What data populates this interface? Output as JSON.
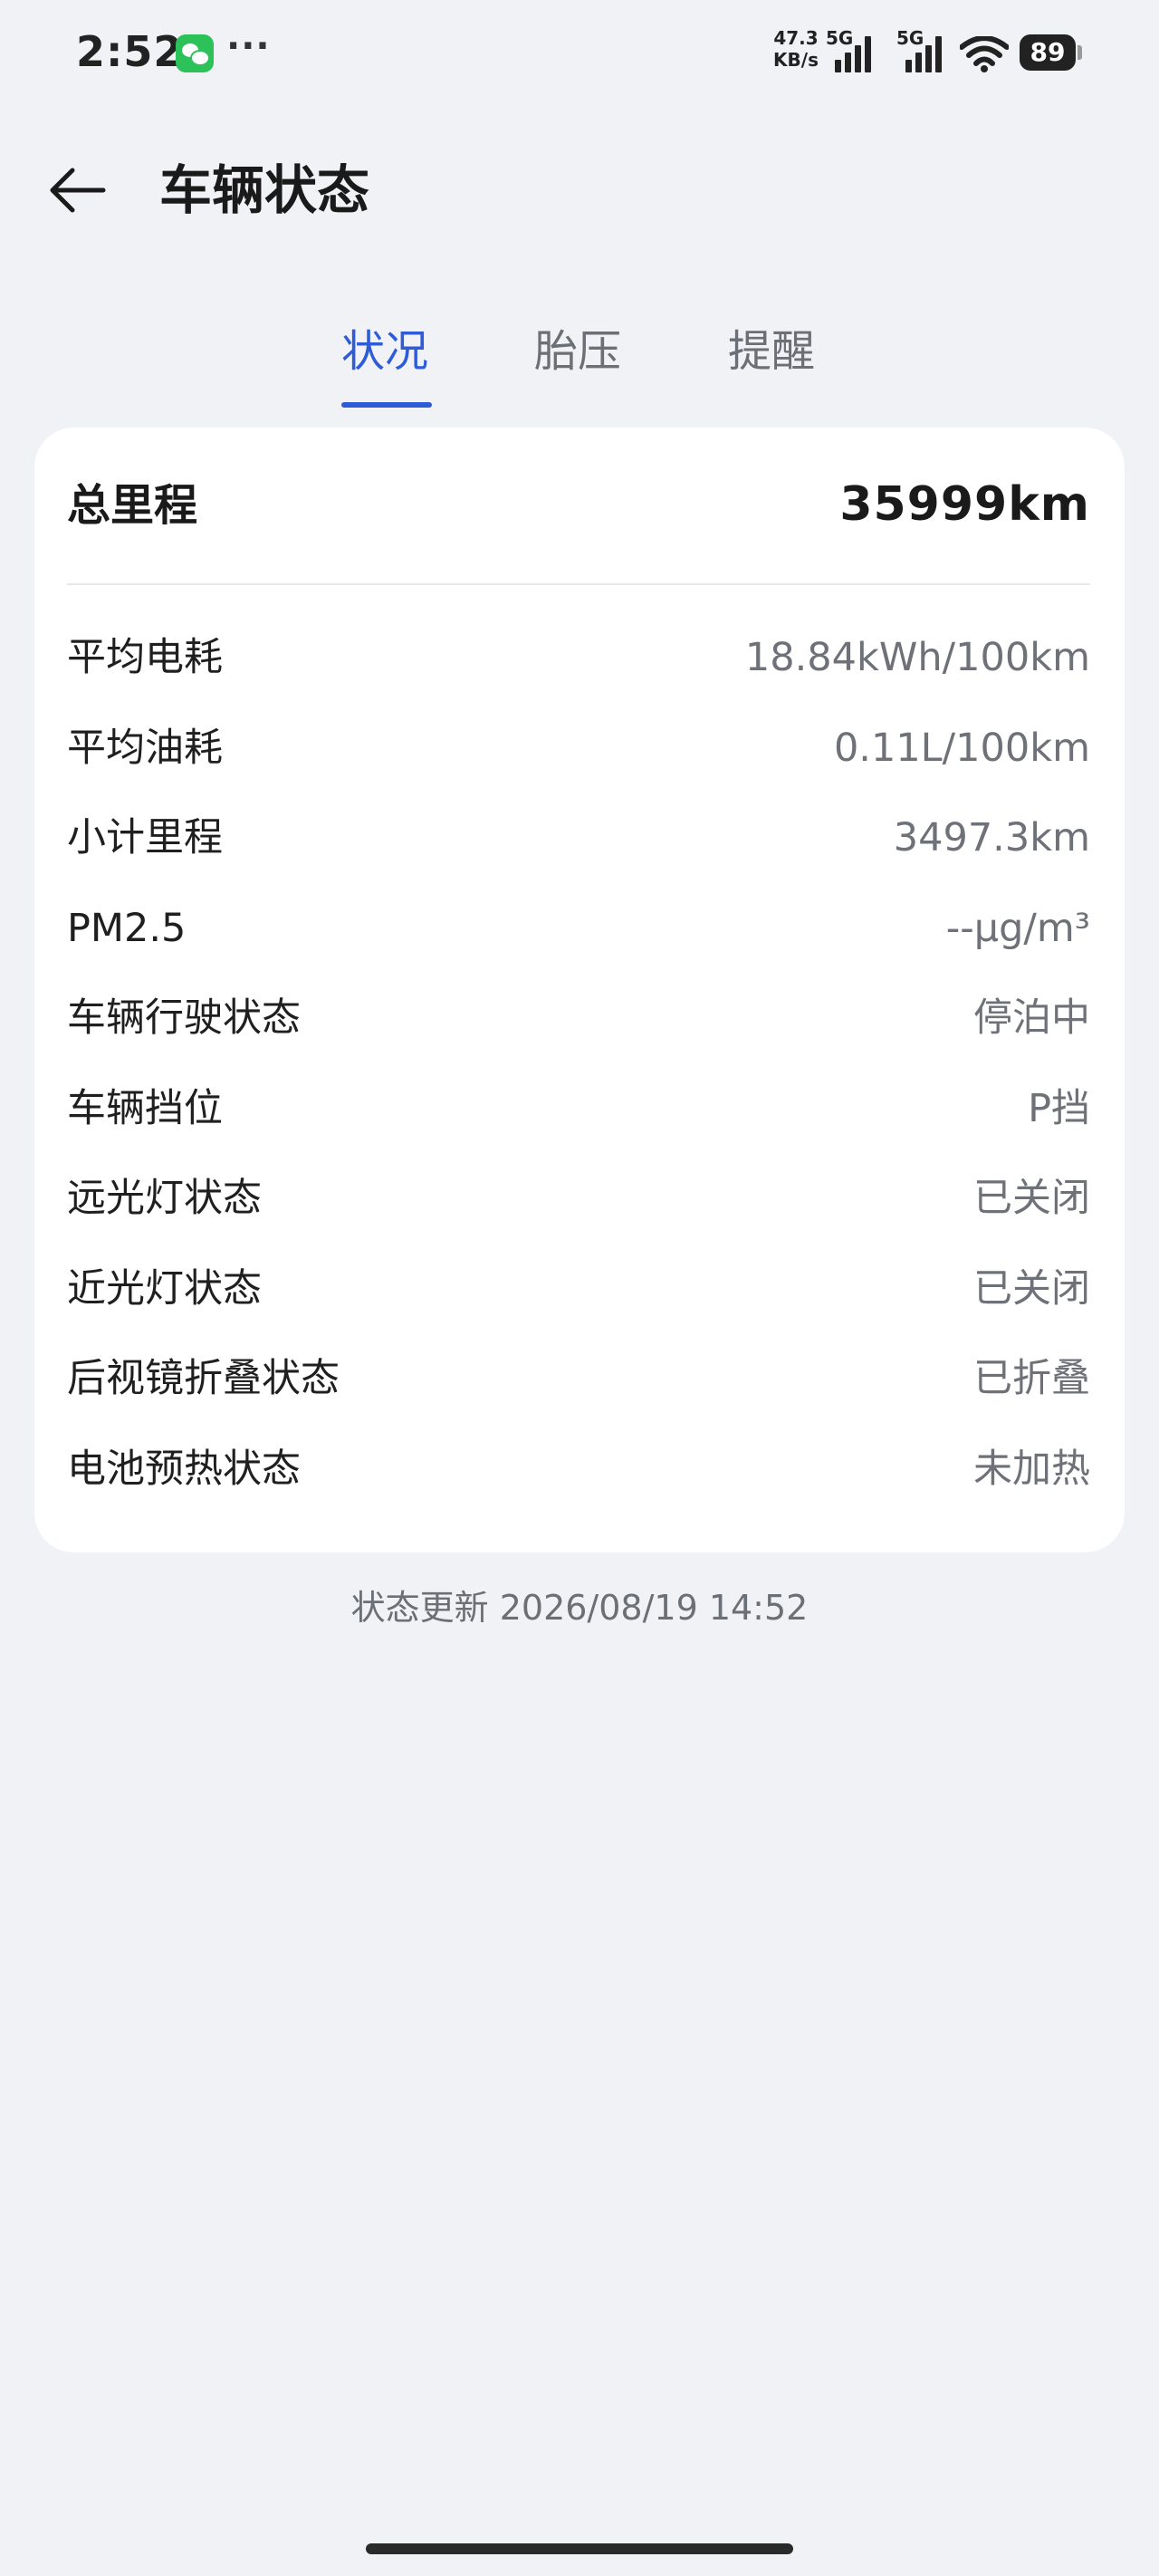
{
  "status_bar": {
    "time": "2:52",
    "more": "···",
    "net_speed_value": "47.3",
    "net_speed_unit": "KB/s",
    "signal1_label": "5G",
    "signal2_label": "5G",
    "battery": "89"
  },
  "header": {
    "title": "车辆状态"
  },
  "tabs": [
    {
      "label": "状况",
      "active": true
    },
    {
      "label": "胎压",
      "active": false
    },
    {
      "label": "提醒",
      "active": false
    }
  ],
  "card": {
    "total": {
      "label": "总里程",
      "value": "35999km"
    },
    "rows": [
      {
        "label": "平均电耗",
        "value": "18.84kWh/100km"
      },
      {
        "label": "平均油耗",
        "value": "0.11L/100km"
      },
      {
        "label": "小计里程",
        "value": "3497.3km"
      },
      {
        "label": "PM2.5",
        "value": "--μg/m³"
      },
      {
        "label": "车辆行驶状态",
        "value": "停泊中"
      },
      {
        "label": "车辆挡位",
        "value": "P挡"
      },
      {
        "label": "远光灯状态",
        "value": "已关闭"
      },
      {
        "label": "近光灯状态",
        "value": "已关闭"
      },
      {
        "label": "后视镜折叠状态",
        "value": "已折叠"
      },
      {
        "label": "电池预热状态",
        "value": "未加热"
      }
    ]
  },
  "update_time": "状态更新 2026/08/19 14:52",
  "colors": {
    "accent": "#2e5bd6",
    "background": "#f1f2f5",
    "card": "#ffffff",
    "wechat": "#2dc15a"
  },
  "icons": {
    "back": "arrow-left-icon",
    "wechat": "wechat-icon",
    "wifi": "wifi-icon",
    "signal": "cellular-signal-icon",
    "battery": "battery-icon"
  }
}
